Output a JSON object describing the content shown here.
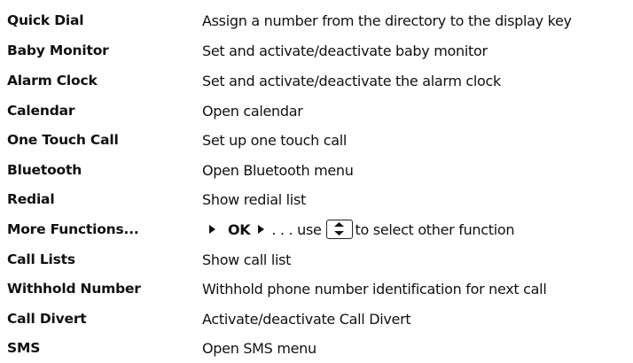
{
  "rows": [
    {
      "name": "Quick Dial",
      "desc": "Assign a number from the directory to the display key"
    },
    {
      "name": "Baby Monitor",
      "desc": "Set and activate/deactivate baby monitor"
    },
    {
      "name": "Alarm Clock",
      "desc": "Set and activate/deactivate the alarm clock"
    },
    {
      "name": "Calendar",
      "desc": "Open calendar"
    },
    {
      "name": "One Touch Call",
      "desc": "Set up one touch call"
    },
    {
      "name": "Bluetooth",
      "desc": "Open Bluetooth menu"
    },
    {
      "name": "Redial",
      "desc": "Show redial list"
    },
    {
      "name": "More Functions...",
      "desc_ok": "OK",
      "desc_mid": ". . . use",
      "desc_end": "to select other function"
    },
    {
      "name": "Call Lists",
      "desc": "Show call list"
    },
    {
      "name": "Withhold Number",
      "desc": "Withhold phone number identification for next call"
    },
    {
      "name": "Call Divert",
      "desc": "Activate/deactivate Call Divert"
    },
    {
      "name": "SMS",
      "desc": "Open SMS menu"
    }
  ],
  "icons": {
    "arrow": "triangle-right-icon",
    "key": "control-key-up-down-icon"
  }
}
